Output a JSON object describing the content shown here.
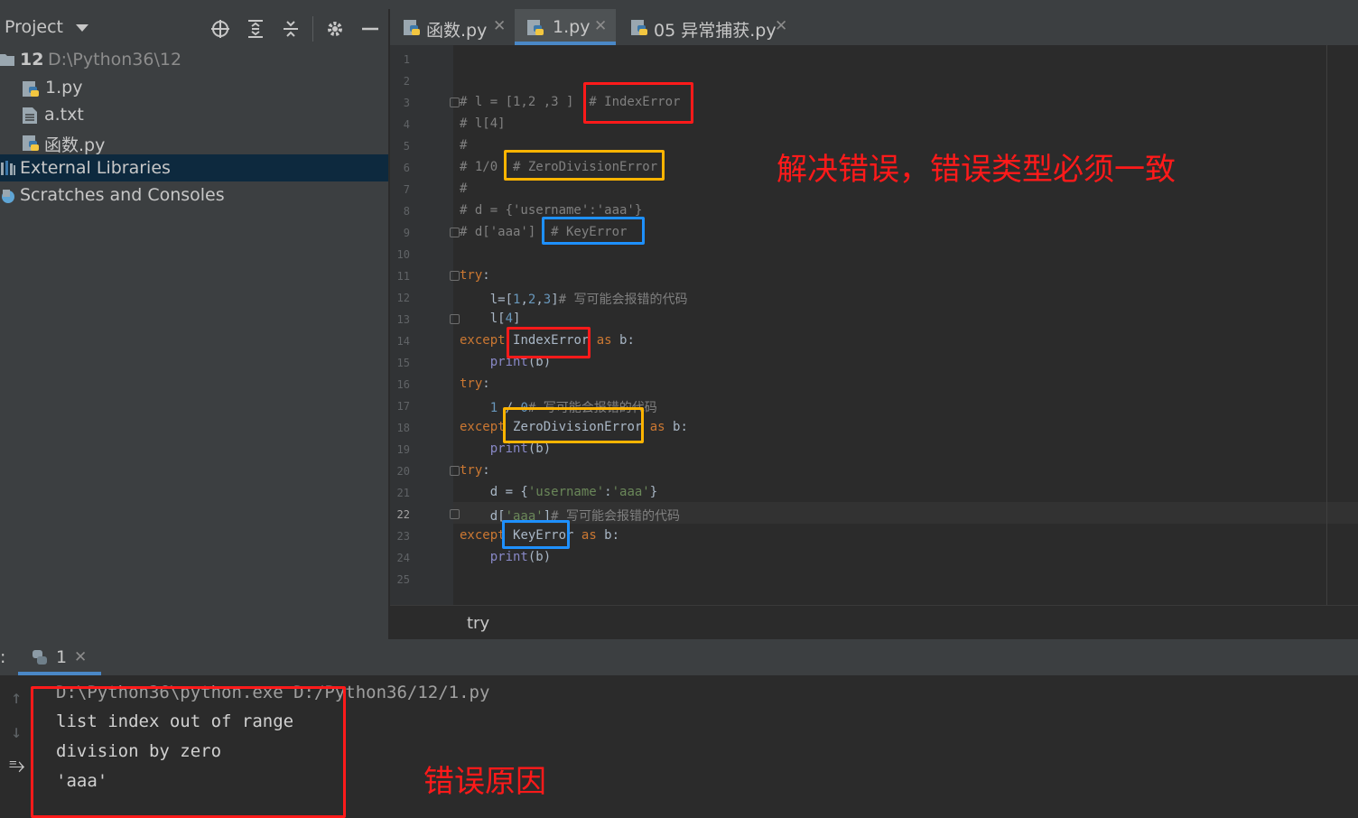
{
  "sidebar": {
    "title": "Project",
    "tree": [
      {
        "label": "12",
        "path": "D:\\Python36\\12"
      },
      {
        "label": "1.py"
      },
      {
        "label": "a.txt"
      },
      {
        "label": "函数.py"
      },
      {
        "label": "External Libraries"
      },
      {
        "label": "Scratches and Consoles"
      }
    ]
  },
  "tabs": [
    {
      "label": "函数.py"
    },
    {
      "label": "1.py"
    },
    {
      "label": "05 异常捕获.py"
    }
  ],
  "editor": {
    "line_numbers": [
      "1",
      "2",
      "3",
      "4",
      "5",
      "6",
      "7",
      "8",
      "9",
      "10",
      "11",
      "12",
      "13",
      "14",
      "15",
      "16",
      "17",
      "18",
      "19",
      "20",
      "21",
      "22",
      "23",
      "24",
      "25"
    ],
    "breadcrumb": "try"
  },
  "run": {
    "colon": ":",
    "tab_label": "1",
    "output": [
      "D:\\Python36\\python.exe D:/Python36/12/1.py",
      "list index out of range",
      "division by zero",
      "'aaa'"
    ]
  },
  "annotations": {
    "note_top": "解决错误，错误类型必须一致",
    "note_bottom": "错误原因"
  },
  "colors": {
    "accent": "#4a88c7",
    "annot_red": "#ff1a1a",
    "annot_yellow": "#ffb400",
    "annot_blue": "#1e90ff"
  }
}
